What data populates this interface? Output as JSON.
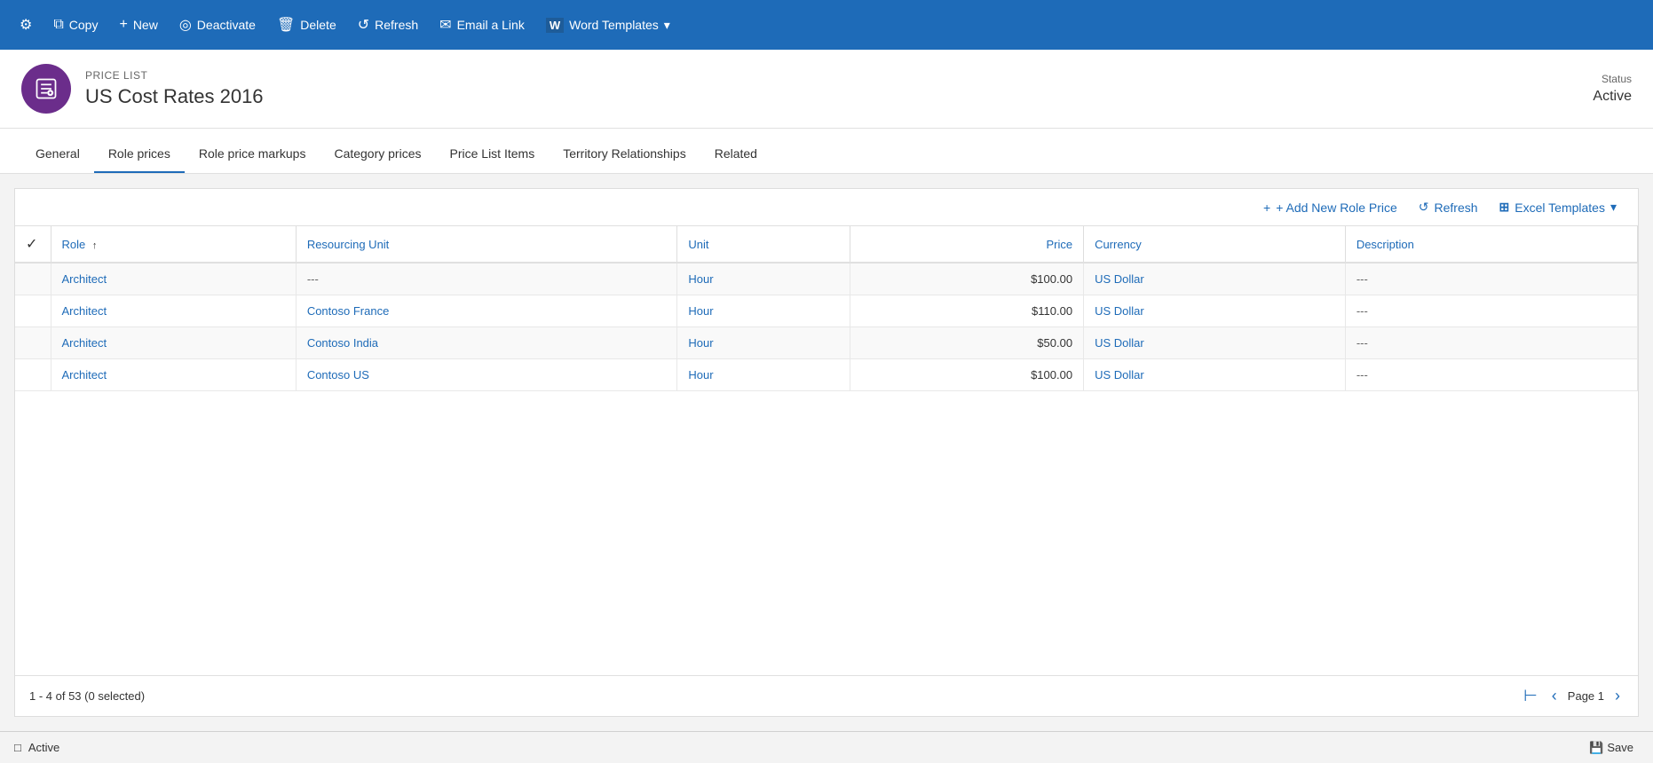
{
  "toolbar": {
    "buttons": [
      {
        "id": "settings",
        "icon": "⚙",
        "label": ""
      },
      {
        "id": "copy",
        "icon": "⧉",
        "label": "Copy"
      },
      {
        "id": "new",
        "icon": "+",
        "label": "New"
      },
      {
        "id": "deactivate",
        "icon": "◎",
        "label": "Deactivate"
      },
      {
        "id": "delete",
        "icon": "🗑",
        "label": "Delete"
      },
      {
        "id": "refresh",
        "icon": "↺",
        "label": "Refresh"
      },
      {
        "id": "email",
        "icon": "✉",
        "label": "Email a Link"
      },
      {
        "id": "word",
        "icon": "W",
        "label": "Word Templates",
        "hasDropdown": true
      }
    ]
  },
  "header": {
    "entity_type": "PRICE LIST",
    "title": "US Cost Rates 2016",
    "status_label": "Status",
    "status_value": "Active"
  },
  "tabs": [
    {
      "id": "general",
      "label": "General",
      "active": false
    },
    {
      "id": "role-prices",
      "label": "Role prices",
      "active": true
    },
    {
      "id": "role-price-markups",
      "label": "Role price markups",
      "active": false
    },
    {
      "id": "category-prices",
      "label": "Category prices",
      "active": false
    },
    {
      "id": "price-list-items",
      "label": "Price List Items",
      "active": false
    },
    {
      "id": "territory-relationships",
      "label": "Territory Relationships",
      "active": false
    },
    {
      "id": "related",
      "label": "Related",
      "active": false
    }
  ],
  "grid": {
    "toolbar": {
      "add_label": "+ Add New Role Price",
      "refresh_label": "Refresh",
      "excel_label": "Excel Templates"
    },
    "columns": [
      {
        "id": "check",
        "label": ""
      },
      {
        "id": "role",
        "label": "Role"
      },
      {
        "id": "resourcing-unit",
        "label": "Resourcing Unit"
      },
      {
        "id": "unit",
        "label": "Unit"
      },
      {
        "id": "price",
        "label": "Price"
      },
      {
        "id": "currency",
        "label": "Currency"
      },
      {
        "id": "description",
        "label": "Description"
      }
    ],
    "rows": [
      {
        "role": "Architect",
        "resourcing_unit": "---",
        "unit": "Hour",
        "price": "$100.00",
        "currency": "US Dollar",
        "description": "---"
      },
      {
        "role": "Architect",
        "resourcing_unit": "Contoso France",
        "unit": "Hour",
        "price": "$110.00",
        "currency": "US Dollar",
        "description": "---"
      },
      {
        "role": "Architect",
        "resourcing_unit": "Contoso India",
        "unit": "Hour",
        "price": "$50.00",
        "currency": "US Dollar",
        "description": "---"
      },
      {
        "role": "Architect",
        "resourcing_unit": "Contoso US",
        "unit": "Hour",
        "price": "$100.00",
        "currency": "US Dollar",
        "description": "---"
      }
    ],
    "pagination": {
      "summary": "1 - 4 of 53 (0 selected)",
      "page_label": "Page 1"
    }
  },
  "status_bar": {
    "status": "Active",
    "save_label": "Save"
  }
}
